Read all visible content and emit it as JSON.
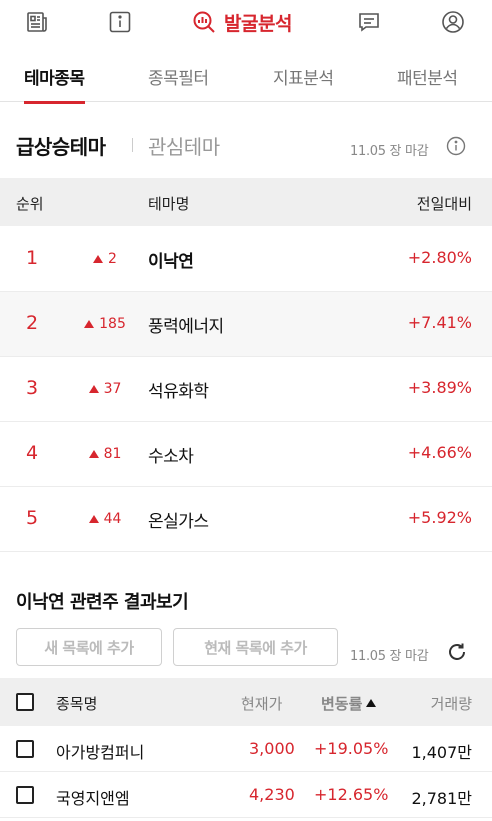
{
  "nav": {
    "active_label": "발굴분석",
    "icons": [
      "news-icon",
      "info-icon",
      "analysis-icon",
      "chat-icon",
      "profile-icon"
    ]
  },
  "tabs": [
    {
      "label": "테마종목",
      "active": true
    },
    {
      "label": "종목필터",
      "active": false
    },
    {
      "label": "지표분석",
      "active": false
    },
    {
      "label": "패턴분석",
      "active": false
    }
  ],
  "subtabs": {
    "active": "급상승테마",
    "inactive": "관심테마"
  },
  "close_time": "11.05 장 마감",
  "theme_table": {
    "headers": {
      "rank": "순위",
      "name": "테마명",
      "change": "전일대비"
    },
    "rows": [
      {
        "rank": "1",
        "move": "2",
        "name": "이낙연",
        "change": "+2.80%",
        "selected": true
      },
      {
        "rank": "2",
        "move": "185",
        "name": "풍력에너지",
        "change": "+7.41%",
        "selected": false
      },
      {
        "rank": "3",
        "move": "37",
        "name": "석유화학",
        "change": "+3.89%",
        "selected": false
      },
      {
        "rank": "4",
        "move": "81",
        "name": "수소차",
        "change": "+4.66%",
        "selected": false
      },
      {
        "rank": "5",
        "move": "44",
        "name": "온실가스",
        "change": "+5.92%",
        "selected": false
      }
    ]
  },
  "result": {
    "title": "이낙연 관련주 결과보기",
    "add_new_label": "새 목록에 추가",
    "add_current_label": "현재 목록에 추가",
    "close_time": "11.05 장 마감"
  },
  "stock_table": {
    "headers": {
      "name": "종목명",
      "price": "현재가",
      "change": "변동률",
      "volume": "거래량"
    },
    "rows": [
      {
        "name": "아가방컴퍼니",
        "price": "3,000",
        "change": "+19.05%",
        "volume": "1,407만"
      },
      {
        "name": "국영지앤엠",
        "price": "4,230",
        "change": "+12.65%",
        "volume": "2,781만"
      }
    ]
  },
  "colors": {
    "accent": "#d7262e",
    "header_bg": "#efefef"
  }
}
